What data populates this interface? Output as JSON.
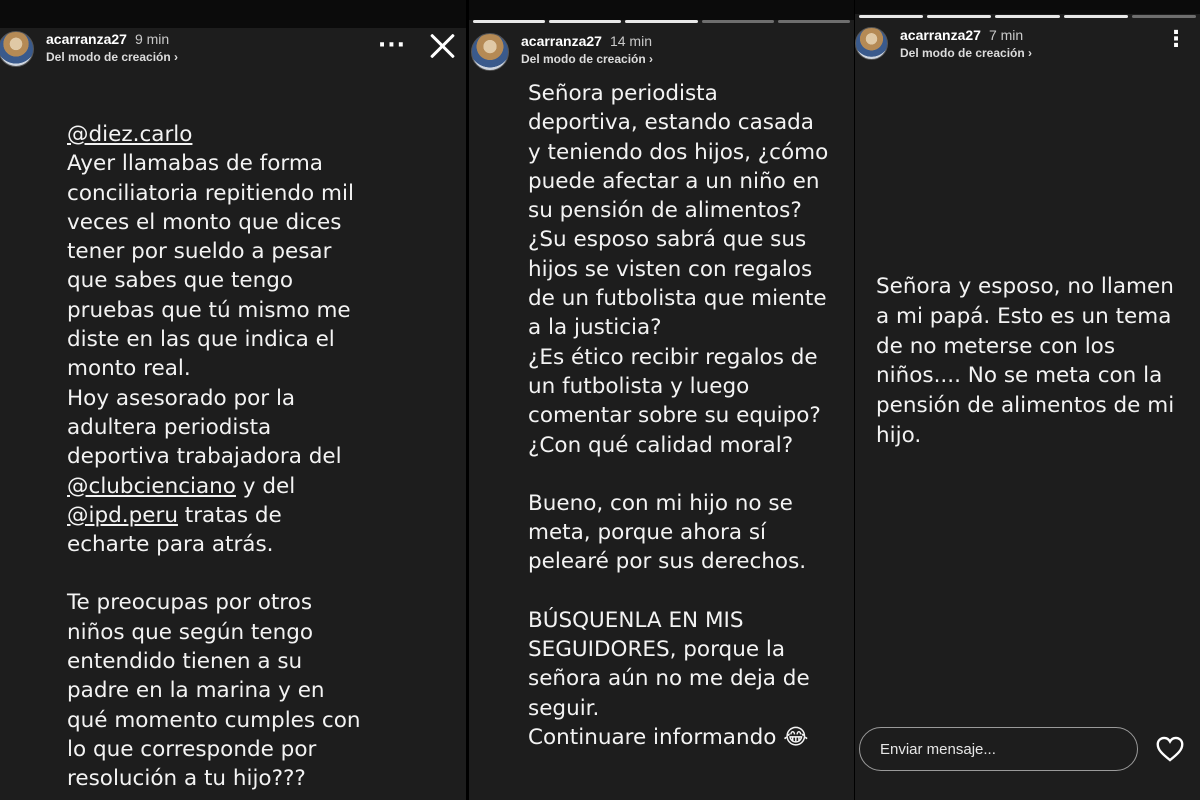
{
  "stories": [
    {
      "username": "acarranza27",
      "time": "9 min",
      "subtitle": "Del modo de creación",
      "text_lines": [
        {
          "mention": "@diez.carlo"
        },
        {
          "text": "Ayer llamabas de forma"
        },
        {
          "text": "conciliatoria repitiendo mil"
        },
        {
          "text": "veces el monto que dices"
        },
        {
          "text": "tener por sueldo a pesar"
        },
        {
          "text": "que sabes que tengo"
        },
        {
          "text": "pruebas que tú mismo me"
        },
        {
          "text": "diste en las que indica el"
        },
        {
          "text": "monto real."
        },
        {
          "text": "Hoy asesorado por la"
        },
        {
          "text": "adultera periodista"
        },
        {
          "text": "deportiva trabajadora del"
        },
        {
          "mention": "@clubcienciano",
          "after": " y del"
        },
        {
          "mention": "@ipd.peru",
          "after": " tratas de"
        },
        {
          "text": "echarte para atrás."
        },
        {
          "spacer": true
        },
        {
          "text": "Te preocupas por otros"
        },
        {
          "text": "niños que según tengo"
        },
        {
          "text": "entendido tienen a su"
        },
        {
          "text": "padre en la marina y en"
        },
        {
          "text": "qué momento cumples con"
        },
        {
          "text": "lo que corresponde por"
        },
        {
          "text": "resolución a tu hijo???"
        }
      ]
    },
    {
      "username": "acarranza27",
      "time": "14 min",
      "subtitle": "Del modo de creación",
      "text_lines": [
        {
          "text": "Señora periodista"
        },
        {
          "text": "deportiva, estando casada"
        },
        {
          "text": "y teniendo dos hijos, ¿cómo"
        },
        {
          "text": "puede afectar a un niño en"
        },
        {
          "text": "su pensión de alimentos?"
        },
        {
          "text": "¿Su esposo sabrá que sus"
        },
        {
          "text": "hijos se visten con regalos"
        },
        {
          "text": "de un futbolista que miente"
        },
        {
          "text": "a la justicia?"
        },
        {
          "text": "¿Es ético recibir regalos de"
        },
        {
          "text": "un futbolista y luego"
        },
        {
          "text": "comentar sobre su equipo?"
        },
        {
          "text": "¿Con qué calidad moral?"
        },
        {
          "spacer": true
        },
        {
          "text": "Bueno, con mi hijo no se"
        },
        {
          "text": "meta, porque ahora sí"
        },
        {
          "text": "pelearé por sus derechos."
        },
        {
          "spacer": true
        },
        {
          "text": "BÚSQUENLA EN MIS"
        },
        {
          "text": "SEGUIDORES, porque la"
        },
        {
          "text": "señora aún no me deja de"
        },
        {
          "text": "seguir."
        },
        {
          "text": "Continuare informando 😂"
        }
      ]
    },
    {
      "username": "acarranza27",
      "time": "7 min",
      "subtitle": "Del modo de creación",
      "text_lines": [
        {
          "text": "Señora y esposo, no llamen"
        },
        {
          "text": "a mi papá. Esto es un tema"
        },
        {
          "text": "de no meterse con los"
        },
        {
          "text": "niños.... No se meta con la"
        },
        {
          "text": "pensión de alimentos de mi"
        },
        {
          "text": "hijo."
        }
      ]
    }
  ],
  "composer": {
    "placeholder": "Enviar mensaje..."
  },
  "icons": {
    "more": "more-options-icon",
    "close": "close-icon",
    "heart": "heart-icon",
    "chevron": "chevron-right-icon"
  },
  "colors": {
    "panel_bg": "#1d1d1d",
    "text": "#f3f3f3",
    "progress_done": "#e8e8e8",
    "progress_pending": "#6e6e6e"
  }
}
